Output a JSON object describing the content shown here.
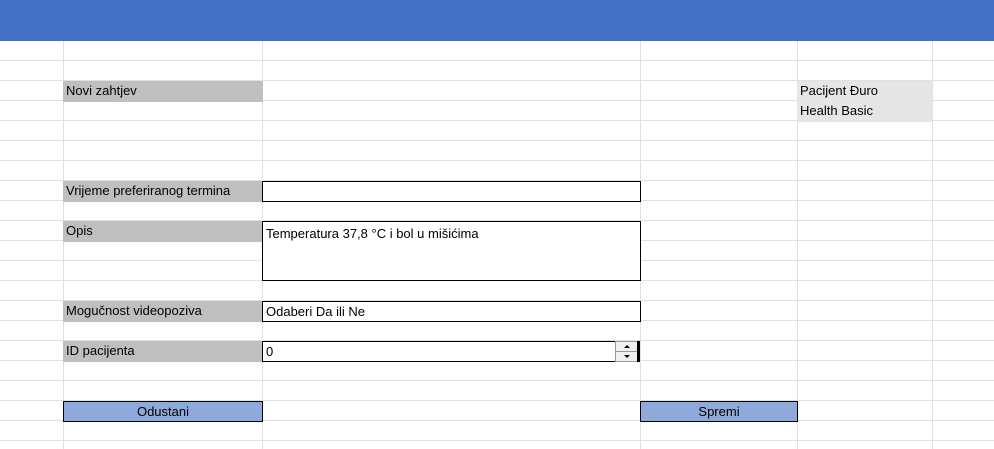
{
  "header": {
    "bar_color": "#4472c4"
  },
  "form": {
    "title": "Novi zahtjev",
    "patient_name": "Pacijent Đuro",
    "patient_plan": "Health Basic",
    "preferred_time_label": "Vrijeme preferiranog termina",
    "preferred_time_value": "",
    "description_label": "Opis",
    "description_value": "Temperatura 37,8 °C i bol u mišićima",
    "video_call_label": "Mogučnost videopoziva",
    "video_call_value": "Odaberi Da ili Ne",
    "patient_id_label": "ID pacijenta",
    "patient_id_value": "0"
  },
  "buttons": {
    "cancel_label": "Odustani",
    "save_label": "Spremi",
    "button_color": "#8eaadb"
  },
  "icons": {
    "spinner_up": "spinner-up-arrow-icon",
    "spinner_down": "spinner-down-arrow-icon"
  }
}
